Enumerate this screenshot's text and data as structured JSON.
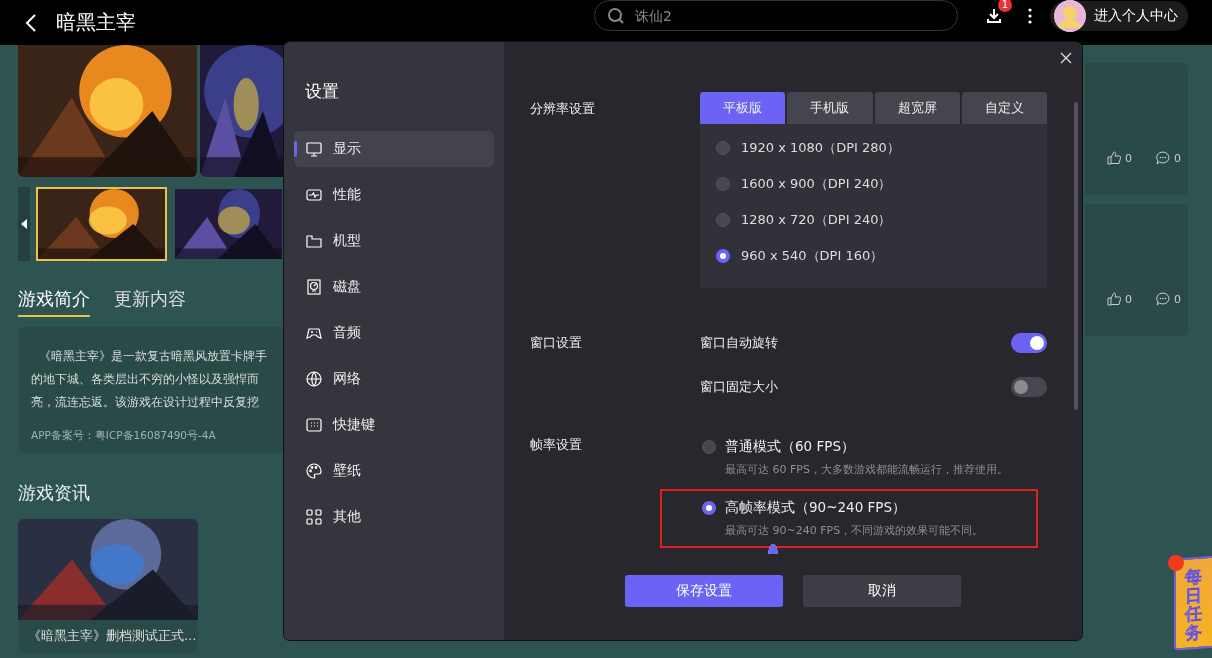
{
  "top_bar": {
    "title": "暗黑主宰",
    "search": {
      "placeholder": "诛仙2"
    },
    "download_badge": "1",
    "profile_label": "进入个人中心"
  },
  "gallery": {
    "banners": [
      {
        "kind": "picture"
      },
      {
        "kind": "picture"
      }
    ],
    "thumbnails": [
      {
        "kind": "picture",
        "selected": true
      },
      {
        "kind": "picture",
        "selected": false
      }
    ]
  },
  "info_tabs": [
    {
      "label": "游戏简介",
      "selected": true
    },
    {
      "label": "更新内容",
      "selected": false
    }
  ],
  "description": {
    "lines": [
      "《暗黑主宰》是一款复古暗黑风放置卡牌手",
      "的地下城、各类层出不穷的小怪以及强悍而",
      "亮，流连忘返。该游戏在设计过程中反复挖"
    ],
    "record": "APP备案号：粤ICP备16087490号-4A"
  },
  "news": {
    "title": "游戏资讯",
    "items": [
      {
        "kind": "picture",
        "caption": "《暗黑主宰》删档测试正式…"
      }
    ]
  },
  "side_posts": [
    {
      "likes": "0",
      "comments": "0"
    },
    {
      "likes": "0",
      "comments": "0"
    }
  ],
  "settings": {
    "title": "设置",
    "nav": [
      {
        "label": "显示",
        "selected": true
      },
      {
        "label": "性能",
        "selected": false
      },
      {
        "label": "机型",
        "selected": false
      },
      {
        "label": "磁盘",
        "selected": false
      },
      {
        "label": "音频",
        "selected": false
      },
      {
        "label": "网络",
        "selected": false
      },
      {
        "label": "快捷键",
        "selected": false
      },
      {
        "label": "壁纸",
        "selected": false
      },
      {
        "label": "其他",
        "selected": false
      }
    ],
    "resolution": {
      "label": "分辨率设置",
      "tabs": [
        {
          "label": "平板版",
          "selected": true
        },
        {
          "label": "手机版",
          "selected": false
        },
        {
          "label": "超宽屏",
          "selected": false
        },
        {
          "label": "自定义",
          "selected": false
        }
      ],
      "options": [
        {
          "label": "1920 x 1080（DPI 280）",
          "selected": false
        },
        {
          "label": "1600 x 900（DPI 240）",
          "selected": false
        },
        {
          "label": "1280 x 720（DPI 240）",
          "selected": false
        },
        {
          "label": "960 x 540（DPI 160）",
          "selected": true
        }
      ]
    },
    "window": {
      "label": "窗口设置",
      "toggles": [
        {
          "label": "窗口自动旋转",
          "on": true
        },
        {
          "label": "窗口固定大小",
          "on": false
        }
      ]
    },
    "frame_rate": {
      "label": "帧率设置",
      "options": [
        {
          "label": "普通模式（60 FPS）",
          "hint": "最高可达 60 FPS，大多数游戏都能流畅运行，推荐使用。",
          "selected": false,
          "highlighted": false
        },
        {
          "label": "高帧率模式（90~240 FPS）",
          "hint": "最高可达 90~240 FPS，不同游戏的效果可能不同。",
          "selected": true,
          "highlighted": true
        }
      ],
      "sub_options": [
        {
          "selected": true
        }
      ]
    },
    "buttons": [
      {
        "label": "保存设置",
        "kind": "primary"
      },
      {
        "label": "取消",
        "kind": "secondary"
      }
    ]
  },
  "daily_task": {
    "label": "每日任务"
  }
}
